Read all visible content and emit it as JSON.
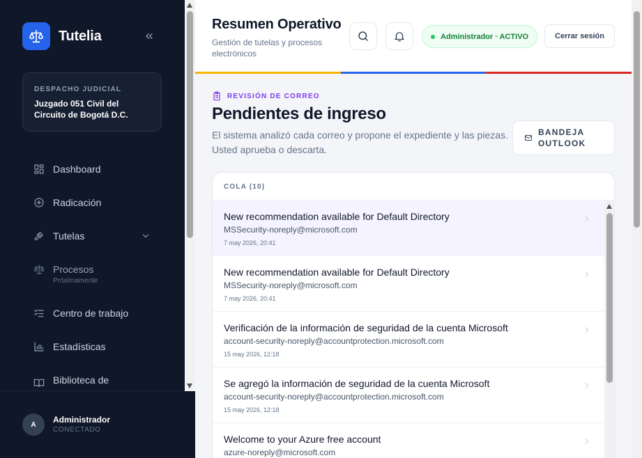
{
  "app": {
    "name": "Tutelia"
  },
  "sidebar": {
    "court": {
      "label": "DESPACHO JUDICIAL",
      "name": "Juzgado 051 Civil del Circuito de Bogotá D.C."
    },
    "items": [
      {
        "label": "Dashboard",
        "icon": "grid-icon"
      },
      {
        "label": "Radicación",
        "icon": "plus-circle-icon"
      },
      {
        "label": "Tutelas",
        "icon": "gavel-icon",
        "has_submenu": true
      },
      {
        "label": "Procesos",
        "icon": "scale-icon",
        "sub": "Próximamente"
      },
      {
        "label": "Centro de trabajo",
        "icon": "checklist-icon"
      },
      {
        "label": "Estadísticas",
        "icon": "bar-chart-icon"
      },
      {
        "label": "Biblioteca de",
        "icon": "book-icon"
      }
    ],
    "user": {
      "initial": "A",
      "name": "Administrador",
      "status": "CONECTADO"
    }
  },
  "header": {
    "title": "Resumen Operativo",
    "subtitle": "Gestión de tutelas y procesos electrónicos",
    "status": "Administrador · ACTIVO",
    "logout": "Cerrar sesión",
    "flag_colors": [
      "#f5b400",
      "#2563eb",
      "#dc2626"
    ],
    "status_color": "#15803d"
  },
  "page": {
    "kicker": "REVISIÓN DE CORREO",
    "title": "Pendientes de ingreso",
    "description": "El sistema analizó cada correo y propone el expediente y las piezas. Usted aprueba o descarta.",
    "outlook_button": "BANDEJA OUTLOOK"
  },
  "queue": {
    "title": "COLA (10)",
    "items": [
      {
        "subject": "New recommendation available for Default Directory",
        "from": "MSSecurity-noreply@microsoft.com",
        "date": "7 may 2026, 20:41",
        "selected": true
      },
      {
        "subject": "New recommendation available for Default Directory",
        "from": "MSSecurity-noreply@microsoft.com",
        "date": "7 may 2026, 20:41",
        "selected": false
      },
      {
        "subject": "Verificación de la información de seguridad de la cuenta Microsoft",
        "from": "account-security-noreply@accountprotection.microsoft.com",
        "date": "15 may 2026, 12:18",
        "selected": false
      },
      {
        "subject": "Se agregó la información de seguridad de la cuenta Microsoft",
        "from": "account-security-noreply@accountprotection.microsoft.com",
        "date": "15 may 2026, 12:18",
        "selected": false
      },
      {
        "subject": "Welcome to your Azure free account",
        "from": "azure-noreply@microsoft.com",
        "date": "",
        "selected": false
      }
    ]
  }
}
